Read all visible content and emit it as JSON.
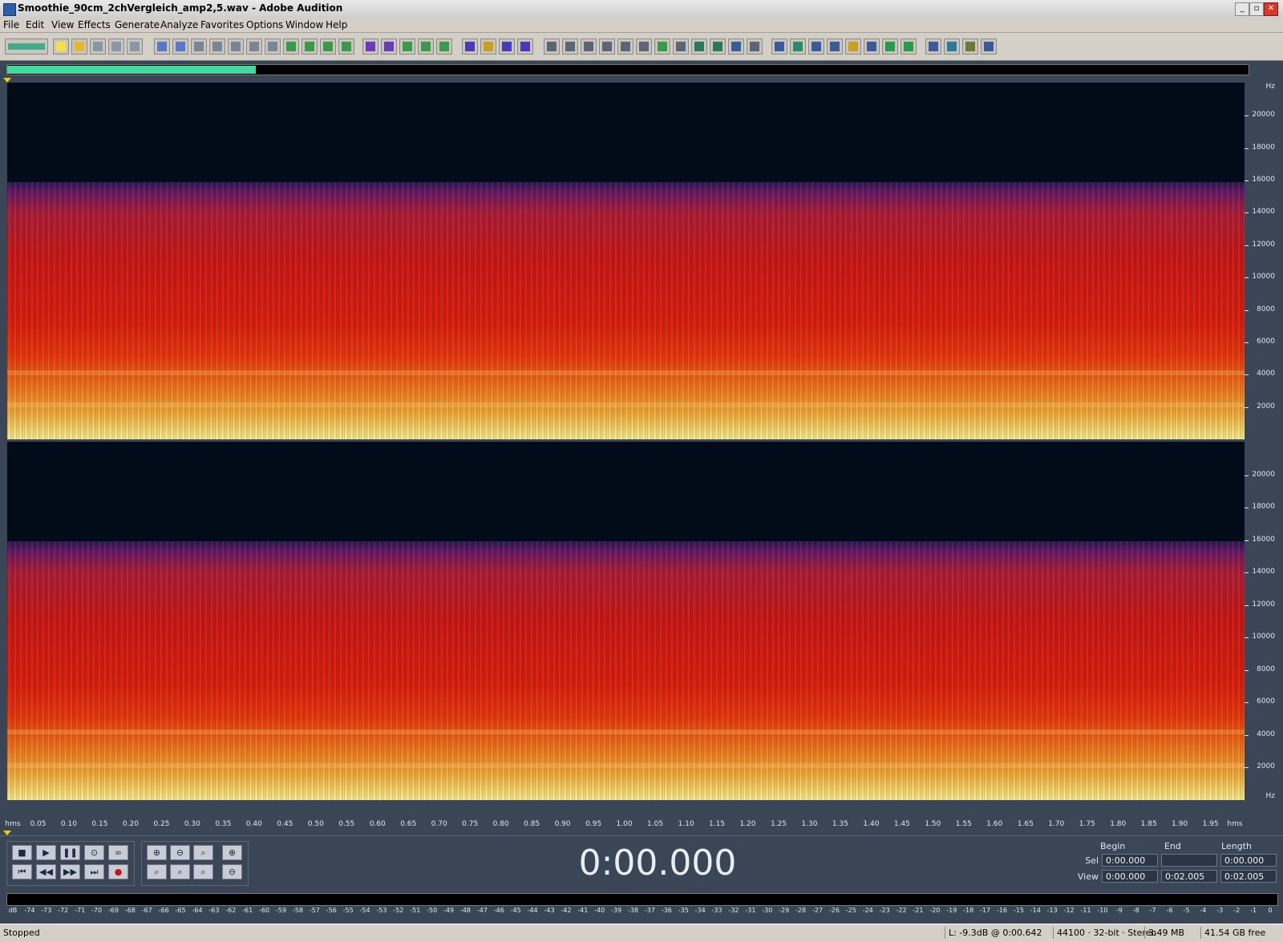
{
  "window": {
    "title": "Smoothie_90cm_2chVergleich_amp2,5.wav - Adobe Audition"
  },
  "menu": [
    "File",
    "Edit",
    "View",
    "Effects",
    "Generate",
    "Analyze",
    "Favorites",
    "Options",
    "Window",
    "Help"
  ],
  "hz_unit": "Hz",
  "hz_ticks": [
    "20000",
    "18000",
    "16000",
    "14000",
    "12000",
    "10000",
    "8000",
    "6000",
    "4000",
    "2000"
  ],
  "time_ruler": {
    "unit": "hms",
    "ticks": [
      "0.05",
      "0.10",
      "0.15",
      "0.20",
      "0.25",
      "0.30",
      "0.35",
      "0.40",
      "0.45",
      "0.50",
      "0.55",
      "0.60",
      "0.65",
      "0.70",
      "0.75",
      "0.80",
      "0.85",
      "0.90",
      "0.95",
      "1.00",
      "1.05",
      "1.10",
      "1.15",
      "1.20",
      "1.25",
      "1.30",
      "1.35",
      "1.40",
      "1.45",
      "1.50",
      "1.55",
      "1.60",
      "1.65",
      "1.70",
      "1.75",
      "1.80",
      "1.85",
      "1.90",
      "1.95"
    ]
  },
  "transport": {
    "time_display": "0:00.000"
  },
  "selection": {
    "headers": {
      "begin": "Begin",
      "end": "End",
      "length": "Length"
    },
    "sel": {
      "label": "Sel",
      "begin": "0:00.000",
      "end": "",
      "length": "0:00.000"
    },
    "view": {
      "label": "View",
      "begin": "0:00.000",
      "end": "0:02.005",
      "length": "0:02.005"
    }
  },
  "level_scale": [
    "dB",
    "-74",
    "-73",
    "-72",
    "-71",
    "-70",
    "-69",
    "-68",
    "-67",
    "-66",
    "-65",
    "-64",
    "-63",
    "-62",
    "-61",
    "-60",
    "-59",
    "-58",
    "-57",
    "-56",
    "-55",
    "-54",
    "-53",
    "-52",
    "-51",
    "-50",
    "-49",
    "-48",
    "-47",
    "-46",
    "-45",
    "-44",
    "-43",
    "-42",
    "-41",
    "-40",
    "-39",
    "-38",
    "-37",
    "-36",
    "-35",
    "-34",
    "-33",
    "-32",
    "-31",
    "-30",
    "-29",
    "-28",
    "-27",
    "-26",
    "-25",
    "-24",
    "-23",
    "-22",
    "-21",
    "-20",
    "-19",
    "-18",
    "-17",
    "-16",
    "-15",
    "-14",
    "-13",
    "-12",
    "-11",
    "-10",
    "-9",
    "-8",
    "-7",
    "-6",
    "-5",
    "-4",
    "-3",
    "-2",
    "-1",
    "0"
  ],
  "status": {
    "state": "Stopped",
    "level": "L: -9.3dB @  0:00.642",
    "format": "44100 · 32-bit · Stereo",
    "size": "3.49 MB",
    "free": "41.54 GB free"
  },
  "overview_progress": 0.2
}
